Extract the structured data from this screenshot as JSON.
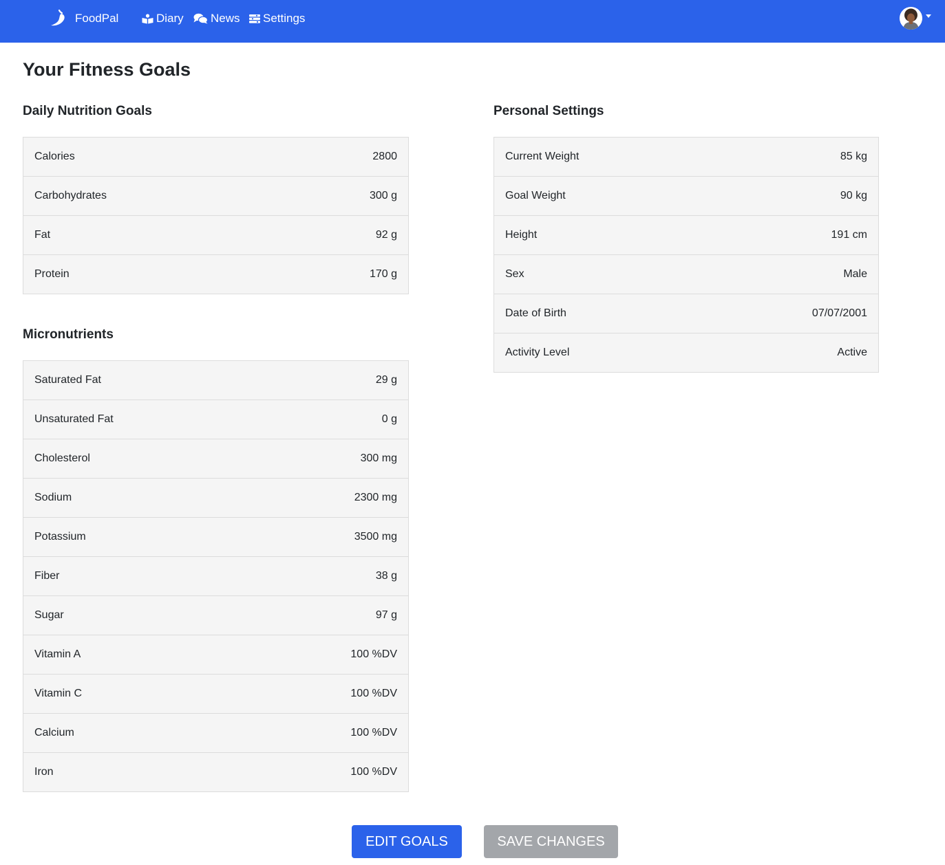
{
  "navbar": {
    "brand": "FoodPal",
    "links": [
      {
        "label": "Diary",
        "icon": "book-reader-icon"
      },
      {
        "label": "News",
        "icon": "comments-icon"
      },
      {
        "label": "Settings",
        "icon": "settings-bars-icon"
      }
    ],
    "color": "#2b62ea"
  },
  "page_title": "Your Fitness Goals",
  "daily": {
    "title": "Daily Nutrition Goals",
    "rows": [
      {
        "label": "Calories",
        "value": "2800"
      },
      {
        "label": "Carbohydrates",
        "value": "300 g"
      },
      {
        "label": "Fat",
        "value": "92 g"
      },
      {
        "label": "Protein",
        "value": "170 g"
      }
    ]
  },
  "micro": {
    "title": "Micronutrients",
    "rows": [
      {
        "label": "Saturated Fat",
        "value": "29 g"
      },
      {
        "label": "Unsaturated Fat",
        "value": "0 g"
      },
      {
        "label": "Cholesterol",
        "value": "300 mg"
      },
      {
        "label": "Sodium",
        "value": "2300 mg"
      },
      {
        "label": "Potassium",
        "value": "3500 mg"
      },
      {
        "label": "Fiber",
        "value": "38 g"
      },
      {
        "label": "Sugar",
        "value": "97 g"
      },
      {
        "label": "Vitamin A",
        "value": "100 %DV"
      },
      {
        "label": "Vitamin C",
        "value": "100 %DV"
      },
      {
        "label": "Calcium",
        "value": "100 %DV"
      },
      {
        "label": "Iron",
        "value": "100 %DV"
      }
    ]
  },
  "personal": {
    "title": "Personal Settings",
    "rows": [
      {
        "label": "Current Weight",
        "value": "85 kg"
      },
      {
        "label": "Goal Weight",
        "value": "90 kg"
      },
      {
        "label": "Height",
        "value": "191 cm"
      },
      {
        "label": "Sex",
        "value": "Male"
      },
      {
        "label": "Date of Birth",
        "value": "07/07/2001"
      },
      {
        "label": "Activity Level",
        "value": "Active"
      }
    ]
  },
  "buttons": {
    "edit": "EDIT GOALS",
    "save": "SAVE CHANGES",
    "edit_color": "#2b62ea",
    "save_color": "#a3a6aa"
  }
}
